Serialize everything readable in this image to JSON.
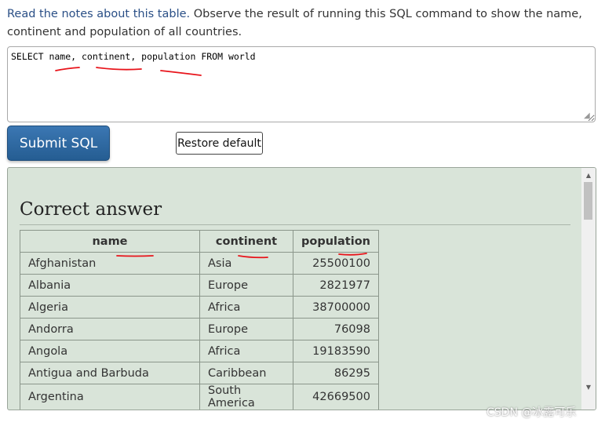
{
  "intro": {
    "link_text": "Read the notes about this table.",
    "text": "Observe the result of running this SQL command to show the name, continent and population of all countries."
  },
  "sql": {
    "value": "SELECT name, continent, population FROM world"
  },
  "buttons": {
    "submit_label": "Submit SQL",
    "restore_label": "Restore default"
  },
  "answer": {
    "title": "Correct answer",
    "columns": [
      "name",
      "continent",
      "population"
    ],
    "rows": [
      [
        "Afghanistan",
        "Asia",
        "25500100"
      ],
      [
        "Albania",
        "Europe",
        "2821977"
      ],
      [
        "Algeria",
        "Africa",
        "38700000"
      ],
      [
        "Andorra",
        "Europe",
        "76098"
      ],
      [
        "Angola",
        "Africa",
        "19183590"
      ],
      [
        "Antigua and Barbuda",
        "Caribbean",
        "86295"
      ],
      [
        "Argentina",
        "South America",
        "42669500"
      ]
    ]
  },
  "scrollbar": {
    "up_icon": "triangle-up",
    "down_icon": "triangle-down"
  },
  "watermark": "CSDN @冰露可乐",
  "colors": {
    "link": "#2a4f86",
    "submit_bg": "#2f6aa4",
    "panel_bg": "#d9e4d9",
    "annotation": "#e8141b"
  }
}
